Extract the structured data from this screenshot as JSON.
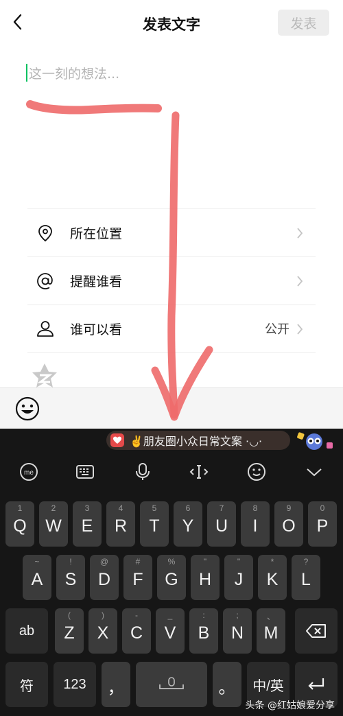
{
  "nav": {
    "title": "发表文字",
    "publish_label": "发表"
  },
  "compose": {
    "placeholder": "这一刻的想法..."
  },
  "options": [
    {
      "label": "所在位置",
      "value": "",
      "icon": "location-pin-icon"
    },
    {
      "label": "提醒谁看",
      "value": "",
      "icon": "at-sign-icon"
    },
    {
      "label": "谁可以看",
      "value": "公开",
      "icon": "person-icon"
    }
  ],
  "keyboard": {
    "suggestion": "✌️朋友圈小众日常文案 ·◡·",
    "toolbar_icons": [
      "ime-logo-icon",
      "keyboard-icon",
      "microphone-icon",
      "cursor-move-icon",
      "emoji-icon",
      "collapse-chevron-icon"
    ],
    "rows": [
      [
        {
          "k": "Q",
          "h": "1"
        },
        {
          "k": "W",
          "h": "2"
        },
        {
          "k": "E",
          "h": "3"
        },
        {
          "k": "R",
          "h": "4"
        },
        {
          "k": "T",
          "h": "5"
        },
        {
          "k": "Y",
          "h": "6"
        },
        {
          "k": "U",
          "h": "7"
        },
        {
          "k": "I",
          "h": "8"
        },
        {
          "k": "O",
          "h": "9"
        },
        {
          "k": "P",
          "h": "0"
        }
      ],
      [
        {
          "k": "A",
          "h": "~"
        },
        {
          "k": "S",
          "h": "!"
        },
        {
          "k": "D",
          "h": "@"
        },
        {
          "k": "F",
          "h": "#"
        },
        {
          "k": "G",
          "h": "%"
        },
        {
          "k": "H",
          "h": "\""
        },
        {
          "k": "J",
          "h": "\""
        },
        {
          "k": "K",
          "h": "*"
        },
        {
          "k": "L",
          "h": "?"
        }
      ],
      [
        {
          "k": "Z",
          "h": "("
        },
        {
          "k": "X",
          "h": ")"
        },
        {
          "k": "C",
          "h": "-"
        },
        {
          "k": "V",
          "h": "_"
        },
        {
          "k": "B",
          "h": ":"
        },
        {
          "k": "N",
          "h": ";"
        },
        {
          "k": "M",
          "h": "、"
        }
      ]
    ],
    "ab_label": "ab",
    "symbol_label": "符",
    "num_label": "123",
    "comma_label": "，",
    "period_label": "。",
    "lang_label": "中/英"
  },
  "watermark": "头条 @红姑娘爱分享",
  "colors": {
    "accent": "#07c160",
    "annotation": "#ee6a6a"
  }
}
